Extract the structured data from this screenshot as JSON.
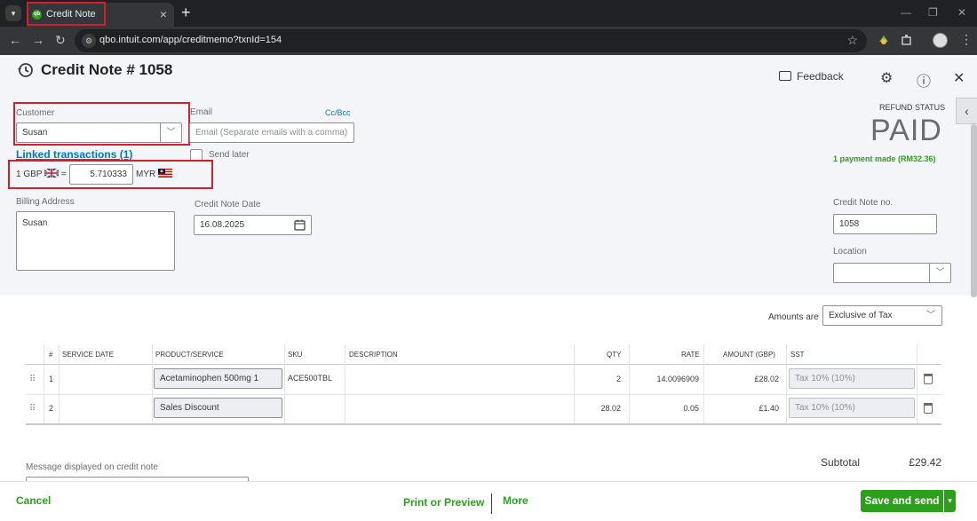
{
  "browser": {
    "tab_title": "Credit Note",
    "tab_close": "×",
    "new_tab": "+",
    "url": "qbo.intuit.com/app/creditmemo?txnId=154",
    "win_min": "—",
    "win_max": "❐",
    "win_close": "✕"
  },
  "header": {
    "title": "Credit Note # 1058",
    "feedback": "Feedback"
  },
  "customer": {
    "label": "Customer",
    "value": "Susan"
  },
  "email": {
    "label": "Email",
    "placeholder": "Email (Separate emails with a comma)",
    "ccbcc": "Cc/Bcc",
    "send_later": "Send later"
  },
  "linked_transactions": "Linked transactions (1)",
  "exchange": {
    "from": "1 GBP",
    "equals": "=",
    "rate": "5.710333",
    "to": "MYR"
  },
  "billing": {
    "label": "Billing Address",
    "value": "Susan"
  },
  "date": {
    "label": "Credit Note Date",
    "value": "16.08.2025"
  },
  "refund": {
    "label": "REFUND STATUS",
    "status": "PAID",
    "payment": "1 payment made (RM32.36)"
  },
  "credit_no": {
    "label": "Credit Note no.",
    "value": "1058"
  },
  "location": {
    "label": "Location",
    "value": ""
  },
  "amounts_are": {
    "label": "Amounts are",
    "value": "Exclusive of Tax"
  },
  "table": {
    "headers": [
      "#",
      "SERVICE DATE",
      "PRODUCT/SERVICE",
      "SKU",
      "DESCRIPTION",
      "QTY",
      "RATE",
      "AMOUNT (GBP)",
      "SST"
    ],
    "rows": [
      {
        "num": "1",
        "product": "Acetaminophen 500mg 1",
        "sku": "ACE500TBL",
        "qty": "2",
        "rate": "14.0096909",
        "amount": "£28.02",
        "tax": "Tax 10% (10%)"
      },
      {
        "num": "2",
        "product": "Sales Discount",
        "sku": "",
        "qty": "28.02",
        "rate": "0.05",
        "amount": "£1.40",
        "tax": "Tax 10% (10%)"
      }
    ]
  },
  "message_label": "Message displayed on credit note",
  "subtotal": {
    "label": "Subtotal",
    "value": "£29.42"
  },
  "footer": {
    "cancel": "Cancel",
    "print": "Print or Preview",
    "more": "More",
    "save": "Save and send"
  },
  "colors": {
    "brand_green": "#2ca01c",
    "link_blue": "#0077c5",
    "highlight_red": "#d3202a"
  }
}
